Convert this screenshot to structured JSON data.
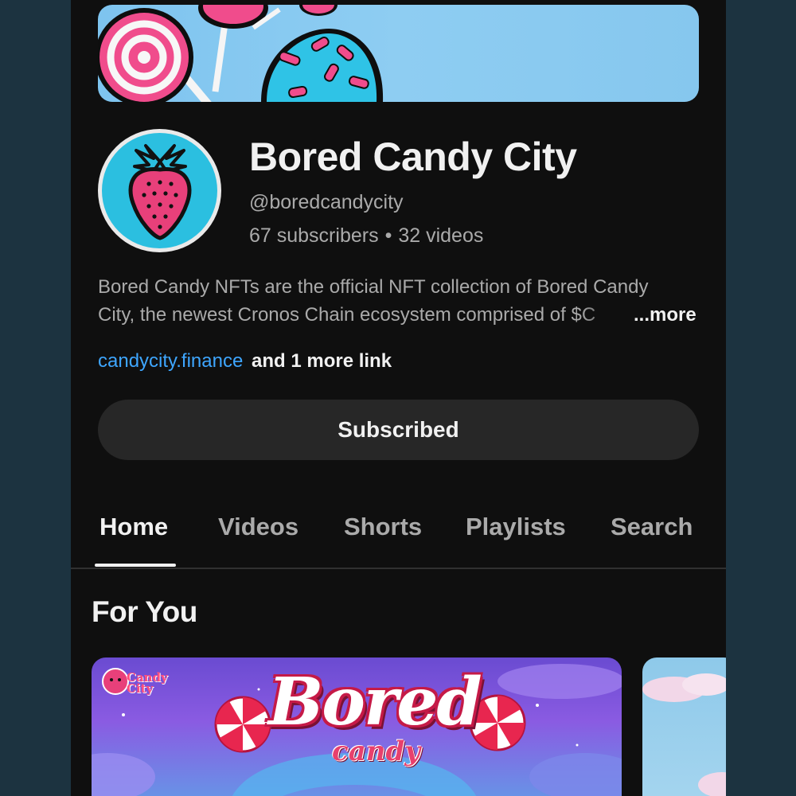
{
  "channel": {
    "name": "Bored Candy City",
    "handle": "@boredcandycity",
    "subscribers": "67 subscribers",
    "separator": "•",
    "videos": "32 videos",
    "description_line1": "Bored Candy NFTs are the official NFT collection of Bored Candy",
    "description_line2": "City, the newest Cronos Chain ecosystem comprised of $C",
    "more_label": "...more",
    "link_text": "candycity.finance",
    "more_links_text": "and 1 more link",
    "subscribe_label": "Subscribed"
  },
  "tabs": [
    {
      "label": "Home",
      "active": true
    },
    {
      "label": "Videos",
      "active": false
    },
    {
      "label": "Shorts",
      "active": false
    },
    {
      "label": "Playlists",
      "active": false
    },
    {
      "label": "Search",
      "active": false
    }
  ],
  "section": {
    "title": "For You"
  },
  "video": {
    "thumbnail_title": "Bored",
    "thumbnail_subtitle": "candy",
    "thumbnail_logo_line1": "Candy",
    "thumbnail_logo_line2": "City"
  },
  "colors": {
    "background": "#0f0f0f",
    "outer_background": "#1c3340",
    "link": "#3ea6ff",
    "button": "#272727",
    "avatar_bg": "#2bbfe0",
    "strawberry": "#e8407a"
  }
}
